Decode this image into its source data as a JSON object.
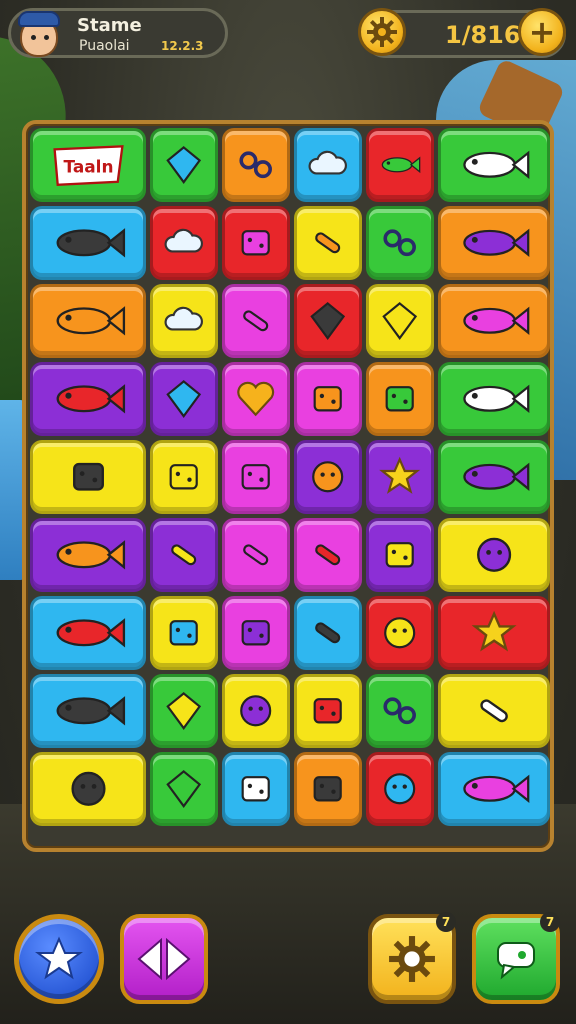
{
  "header": {
    "profile_name": "Stame",
    "profile_subtitle": "Puaolai",
    "profile_score": "12.2.3",
    "counter_value": "1/816",
    "gear_icon": "gear-icon",
    "plus_icon": "plus-icon"
  },
  "colors": {
    "green": "#38c93a",
    "red": "#e8262a",
    "orange": "#f7941d",
    "blue": "#2fb7f0",
    "yellow": "#f6e419",
    "purple": "#8c2fd6",
    "magenta": "#e940e0",
    "board_border": "#b7822f"
  },
  "board": {
    "rows": [
      [
        {
          "color": "green",
          "icon": "sign-text-icon",
          "label": "Taaln"
        },
        {
          "color": "green",
          "icon": "red-gem-icon"
        },
        {
          "color": "orange",
          "icon": "link-icon"
        },
        {
          "color": "blue",
          "icon": "cloud-icon"
        },
        {
          "color": "red",
          "icon": "yellow-fish-icon"
        },
        {
          "color": "green",
          "icon": "sushi-icon"
        }
      ],
      [
        {
          "color": "blue",
          "icon": "red-fish-icon"
        },
        {
          "color": "red",
          "icon": "dumpling-icon"
        },
        {
          "color": "red",
          "icon": "box-icon"
        },
        {
          "color": "yellow",
          "icon": "wrench-icon"
        },
        {
          "color": "green",
          "icon": "magnifier-icon"
        },
        {
          "color": "orange",
          "icon": "dark-fish-icon"
        }
      ],
      [
        {
          "color": "orange",
          "icon": "orange-fish-icon"
        },
        {
          "color": "yellow",
          "icon": "popcorn-icon"
        },
        {
          "color": "magenta",
          "icon": "pencil-box-icon"
        },
        {
          "color": "red",
          "icon": "green-gem-icon"
        },
        {
          "color": "yellow",
          "icon": "pink-gem-icon"
        },
        {
          "color": "orange",
          "icon": "camera-icon"
        }
      ],
      [
        {
          "color": "purple",
          "icon": "rocket-fish-icon"
        },
        {
          "color": "purple",
          "icon": "crystal-icon"
        },
        {
          "color": "magenta",
          "icon": "heart-icon"
        },
        {
          "color": "magenta",
          "icon": "dice-icon"
        },
        {
          "color": "orange",
          "icon": "cheese-icon"
        },
        {
          "color": "green",
          "icon": "red-fish-icon"
        }
      ],
      [
        {
          "color": "yellow",
          "icon": "candy-icon"
        },
        {
          "color": "yellow",
          "icon": "card-icon"
        },
        {
          "color": "magenta",
          "icon": "dice-icon"
        },
        {
          "color": "purple",
          "icon": "shell-icon"
        },
        {
          "color": "purple",
          "icon": "star-icon"
        },
        {
          "color": "green",
          "icon": "projector-icon"
        }
      ],
      [
        {
          "color": "purple",
          "icon": "pink-fish-icon"
        },
        {
          "color": "purple",
          "icon": "bread-icon"
        },
        {
          "color": "magenta",
          "icon": "bottle-icon"
        },
        {
          "color": "magenta",
          "icon": "bone-icon"
        },
        {
          "color": "purple",
          "icon": "abacus-icon"
        },
        {
          "color": "yellow",
          "icon": "cone-icon"
        }
      ],
      [
        {
          "color": "blue",
          "icon": "rocket-icon"
        },
        {
          "color": "yellow",
          "icon": "domino-icon"
        },
        {
          "color": "magenta",
          "icon": "dice-icon"
        },
        {
          "color": "blue",
          "icon": "bone-icon"
        },
        {
          "color": "red",
          "icon": "face-icon"
        },
        {
          "color": "red",
          "icon": "shooting-star-icon"
        }
      ],
      [
        {
          "color": "blue",
          "icon": "whale-icon"
        },
        {
          "color": "green",
          "icon": "pink-gem-icon"
        },
        {
          "color": "yellow",
          "icon": "cookie-icon"
        },
        {
          "color": "yellow",
          "icon": "eraser-icon"
        },
        {
          "color": "green",
          "icon": "link-icon"
        },
        {
          "color": "yellow",
          "icon": "bread-icon"
        }
      ],
      [
        {
          "color": "yellow",
          "icon": "candy-face-icon"
        },
        {
          "color": "green",
          "icon": "bulb-icon"
        },
        {
          "color": "blue",
          "icon": "cube-icon"
        },
        {
          "color": "orange",
          "icon": "tv-icon"
        },
        {
          "color": "red",
          "icon": "chick-icon"
        },
        {
          "color": "blue",
          "icon": "purple-fish-icon"
        }
      ]
    ]
  },
  "bottom_bar": {
    "star_button_icon": "star-icon",
    "diamond_button_icon": "arrows-icon",
    "settings_button_icon": "gear-icon",
    "settings_badge": "7",
    "chat_button_icon": "chat-icon",
    "chat_badge": "7"
  }
}
